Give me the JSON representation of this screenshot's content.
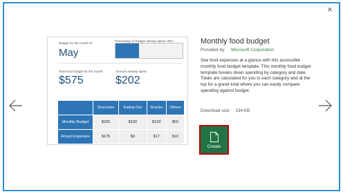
{
  "dialog": {
    "close_label": "×"
  },
  "template": {
    "title": "Monthly food budget",
    "provided_by_label": "Provided by:",
    "provider": "Microsoft Corporation",
    "description": "See food expenses at a glance with this accessible monthly food budget template. This monthly food budget template breaks down spending by category and date. Totals are calculated for you in each category and at the top for a grand total where you can easily compare spending against budget.",
    "download_size_label": "Download size:",
    "download_size": "134 KB",
    "create_label": "Create"
  },
  "preview": {
    "budget_month_label": "Budget for the month of",
    "month": "May",
    "pct_label": "Percentage of budget already spent:",
    "pct_value": "35%",
    "pct_fraction": 0.35,
    "total_label": "Total food budget for the month",
    "total_value": "$575",
    "spent_label": "Amount already spent",
    "spent_value": "$202",
    "table": {
      "headers": [
        "Groceries",
        "Eating Out",
        "Snacks",
        "Others"
      ],
      "rows": [
        {
          "label": "Monthly Budget",
          "values": [
            "$325",
            "$100",
            "$100",
            "$50"
          ]
        },
        {
          "label": "Actual Expenses",
          "values": [
            "$175",
            "$0",
            "$17",
            "$10"
          ]
        }
      ]
    }
  },
  "colors": {
    "accent": "#2b8fd6",
    "excel_green": "#217346",
    "table_blue": "#2e75b6",
    "highlight_red": "#c00000"
  }
}
